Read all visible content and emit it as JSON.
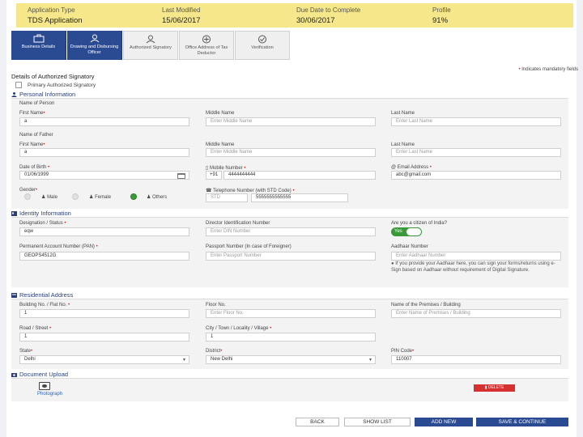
{
  "summary": {
    "application_type_label": "Application Type",
    "application_type": "TDS Application",
    "last_modified_label": "Last Modified",
    "last_modified": "15/06/2017",
    "due_date_label": "Due Date to Complete",
    "due_date": "30/06/2017",
    "profile_label": "Profile",
    "profile": "91%"
  },
  "tabs": [
    {
      "label": "Business Details",
      "icon": "briefcase-icon"
    },
    {
      "label": "Drawing and Disbursing Officer",
      "icon": "officer-icon"
    },
    {
      "label": "Authorized Signatory",
      "icon": "signatory-icon"
    },
    {
      "label": "Office Address of Tax Deductor",
      "icon": "office-address-icon"
    },
    {
      "label": "Verification",
      "icon": "check-circle-icon"
    }
  ],
  "mandatory_note": "Indicates mandatory fields",
  "details_heading": "Details of Authorized Signatory",
  "primary_signatory_label": "Primary Authorized Signatory",
  "personal": {
    "title": "Personal Information",
    "name_of_person": "Name of Person",
    "first_name_label": "First Name",
    "first_name_value": "a",
    "middle_name_label": "Middle Name",
    "middle_name_placeholder": "Enter Middle Name",
    "last_name_label": "Last Name",
    "last_name_placeholder": "Enter Last Name",
    "name_of_father": "Name of Father",
    "father_first_name_label": "First Name",
    "father_first_name_value": "a",
    "father_middle_name_label": "Middle Name",
    "father_middle_name_placeholder": "Enter Middle Name",
    "father_last_name_label": "Last Name",
    "father_last_name_placeholder": "Enter Last Name",
    "dob_label": "Date of Birth",
    "dob_value": "01/06/1999",
    "mobile_label": "Mobile Number",
    "mobile_prefix": "+91",
    "mobile_value": "4444444444",
    "email_label": "Email Address",
    "email_value": "abc@gmail.com",
    "gender_label": "Gender",
    "gender_options": [
      "Male",
      "Female",
      "Others"
    ],
    "gender_selected": "Others",
    "telephone_label": "Telephone Number (with STD Code)",
    "std_placeholder": "STD",
    "telephone_value": "5555555555555"
  },
  "identity": {
    "title": "Identity Information",
    "designation_label": "Designation / Status",
    "designation_value": "eqw",
    "din_label": "Director Identification Number",
    "din_placeholder": "Enter DIN Number",
    "citizen_label": "Are you a citizen of India?",
    "citizen_toggle": "Yes",
    "pan_label": "Permanent Account Number (PAN)",
    "pan_value": "GEOPS4512G",
    "passport_label": "Passport Number (In case of Foreigner)",
    "passport_placeholder": "Enter Passport Number",
    "aadhaar_label": "Aadhaar Number",
    "aadhaar_placeholder": "Enter Aadhaar Number",
    "aadhaar_info": "If you provide your Aadhaar here, you can sign your forms/returns using e-Sign based on Aadhaar without requirement of Digital Signature."
  },
  "address": {
    "title": "Residential Address",
    "building_label": "Building No. / Flat No.",
    "building_value": "1",
    "floor_label": "Floor No.",
    "floor_placeholder": "Enter Floor No.",
    "premises_label": "Name of the Premises / Building",
    "premises_placeholder": "Enter Name of Premises / Building",
    "road_label": "Road / Street",
    "road_value": "1",
    "city_label": "City / Town / Locality / Village",
    "city_value": "1",
    "state_label": "State",
    "state_value": "Delhi",
    "district_label": "District",
    "district_value": "New Delhi",
    "pin_label": "PIN Code",
    "pin_value": "110007"
  },
  "upload": {
    "title": "Document Upload",
    "photo_link": "Photograph",
    "delete_label": "DELETE"
  },
  "buttons": {
    "back": "BACK",
    "show_list": "SHOW LIST",
    "add_new": "ADD NEW",
    "save_continue": "SAVE & CONTINUE"
  },
  "colors": {
    "summary_bg": "#f6e88a",
    "primary": "#2a4a91",
    "toggle_on": "#3a9a3a",
    "delete": "#d63030",
    "required": "#dd2222"
  }
}
